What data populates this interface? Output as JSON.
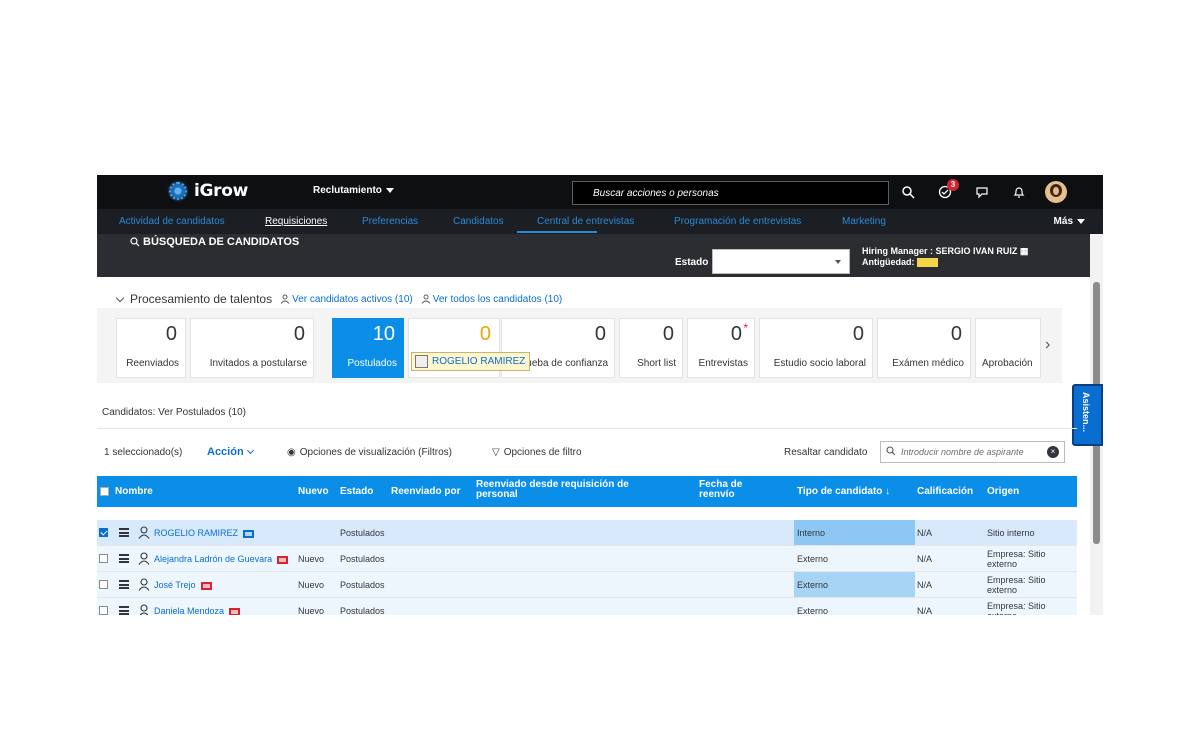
{
  "shell": {
    "logo_text": "iGrow",
    "module_label": "Reclutamiento",
    "search_placeholder": "Buscar acciones o personas",
    "notifications_badge": "3",
    "icons": [
      "search-icon",
      "approvals-icon",
      "chat-icon",
      "bell-icon",
      "avatar"
    ]
  },
  "nav": {
    "items": [
      {
        "label": "Actividad de candidatos"
      },
      {
        "label": "Requisiciones",
        "active": true
      },
      {
        "label": "Preferencias"
      },
      {
        "label": "Candidatos"
      },
      {
        "label": "Central de entrevistas"
      },
      {
        "label": "Programación de entrevistas"
      },
      {
        "label": "Marketing"
      }
    ],
    "more_label": "Más"
  },
  "header": {
    "search_candidates": "BÚSQUEDA DE CANDIDATOS",
    "estado_label": "Estado",
    "estado_value": "",
    "hiring_manager": "Hiring Manager : SERGIO IVAN RUIZ",
    "antiguedad_label": "Antigüedad:"
  },
  "talent": {
    "title": "Procesamiento de talentos",
    "link_active": "Ver candidatos activos (10)",
    "link_all": "Ver todos los candidatos (10)",
    "tiles": [
      {
        "value": "0",
        "label": "Reenviados"
      },
      {
        "value": "0",
        "label": "Invitados a postularse"
      },
      {
        "value": "10",
        "label": "Postulados",
        "selected": true
      },
      {
        "value": "0",
        "label": ""
      },
      {
        "value": "0",
        "label": "Prueba de confianza"
      },
      {
        "value": "0",
        "label": "Short list"
      },
      {
        "value": "0",
        "label": "Entrevistas"
      },
      {
        "value": "0",
        "label": "Estudio socio laboral"
      },
      {
        "value": "0",
        "label": "Exámen médico"
      },
      {
        "value": "",
        "label": "Aprobación"
      }
    ],
    "drag_label": "ROGELIO RAMIREZ"
  },
  "assistant_label": "Asisten...",
  "candidates_caption": "Candidatos: Ver Postulados (10)",
  "toolbar": {
    "selected_count": "1 seleccionado(s)",
    "action_label": "Acción",
    "view_options": "Opciones de visualización (Filtros)",
    "filter_options": "Opciones de filtro",
    "highlight_label": "Resaltar candidato",
    "highlight_placeholder": "Introducir nombre de aspirante"
  },
  "table": {
    "columns": {
      "nombre": "Nombre",
      "nuevo": "Nuevo",
      "estado": "Estado",
      "reenviado_por": "Reenviado por",
      "reenviado_desde": "Reenviado desde requisición de personal",
      "fecha_reenvio": "Fecha de reenvío",
      "tipo": "Tipo de candidato",
      "calificacion": "Calificación",
      "origen": "Origen"
    },
    "rows": [
      {
        "name": "ROGELIO RAMIREZ",
        "nuevo": "",
        "estado": "Postulados",
        "tipo": "Interno",
        "calificacion": "N/A",
        "origen": "Sitio interno",
        "checked": true
      },
      {
        "name": "Alejandra Ladrón de Guevara",
        "nuevo": "Nuevo",
        "estado": "Postulados",
        "tipo": "Externo",
        "calificacion": "N/A",
        "origen": "Empresa: Sitio externo"
      },
      {
        "name": "José Trejo",
        "nuevo": "Nuevo",
        "estado": "Postulados",
        "tipo": "Externo",
        "calificacion": "N/A",
        "origen": "Empresa: Sitio externo"
      },
      {
        "name": "Daniela Mendoza",
        "nuevo": "Nuevo",
        "estado": "Postulados",
        "tipo": "Externo",
        "calificacion": "N/A",
        "origen": "Empresa: Sitio externo"
      }
    ]
  },
  "colors": {
    "accent": "#0a8ee8",
    "shell_bg": "#0e0f10",
    "link": "#0a6ed1"
  }
}
